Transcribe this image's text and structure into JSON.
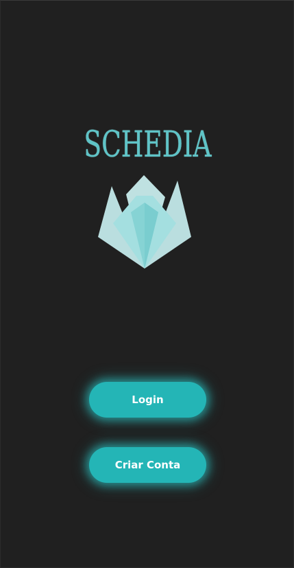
{
  "brand": {
    "wordmark": "SCHEDIA",
    "logo_icon": "lotus-crystal-icon"
  },
  "actions": {
    "login_label": "Login",
    "signup_label": "Criar Conta"
  },
  "colors": {
    "background": "#202020",
    "accent": "#24b5b6",
    "wordmark": "#5fc4c7",
    "logo_light": "#c3e9ea",
    "logo_mid": "#9fdcdd",
    "logo_dark": "#7fd0d2"
  }
}
